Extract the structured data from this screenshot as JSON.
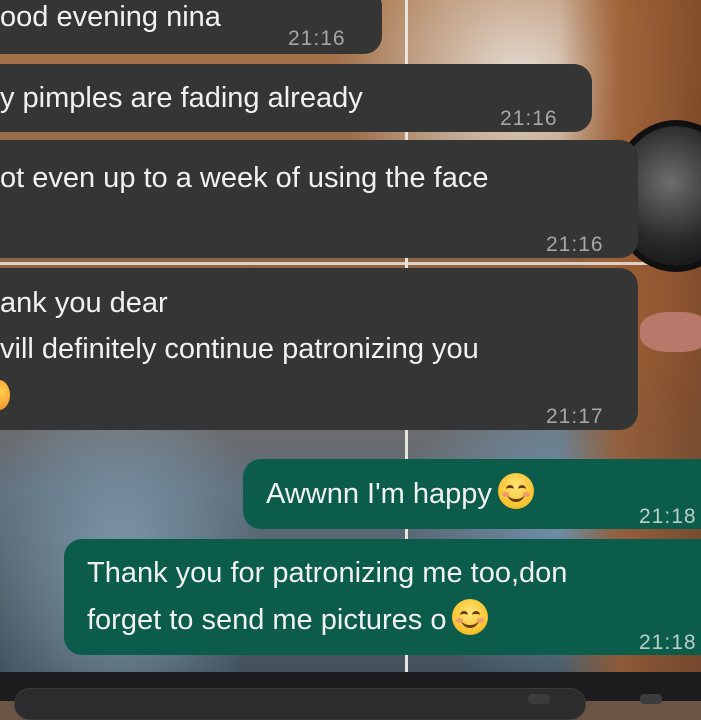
{
  "messages": [
    {
      "direction": "incoming",
      "lines": [
        "ood evening nina"
      ],
      "time": "21:16"
    },
    {
      "direction": "incoming",
      "lines": [
        "y pimples are fading already"
      ],
      "time": "21:16"
    },
    {
      "direction": "incoming",
      "lines": [
        "ot even up to a week of using the face"
      ],
      "time": "21:16"
    },
    {
      "direction": "incoming",
      "lines": [
        "ank you dear",
        "vill definitely continue patronizing you"
      ],
      "time": "21:17"
    },
    {
      "direction": "outgoing",
      "lines": [
        "Awwnn I'm happy"
      ],
      "time": "21:18"
    },
    {
      "direction": "outgoing",
      "lines": [
        "Thank you for patronizing me too,don",
        "forget to send me pictures o"
      ],
      "time": "21:18"
    }
  ],
  "icons": [
    "smiling-face-emoji",
    "partial-emoji"
  ],
  "colors": {
    "incoming_bubble": "#353535",
    "outgoing_bubble": "#0c5c4b",
    "timestamp": "#a6a6a6"
  }
}
